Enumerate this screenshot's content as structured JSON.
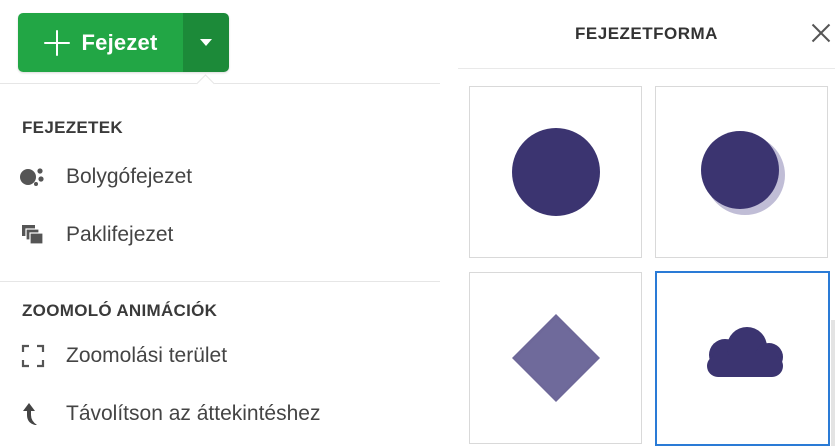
{
  "toolbar": {
    "add_button_label": "Fejezet",
    "add_icon": "plus-icon",
    "dropdown_icon": "caret-down-icon",
    "accent_color": "#22a645",
    "accent_dark": "#1c8a39"
  },
  "menu": {
    "section_chapters": {
      "title": "FEJEZETEK",
      "items": [
        {
          "label": "Bolygófejezet",
          "icon": "planet-topic-icon"
        },
        {
          "label": "Paklifejezet",
          "icon": "stack-topic-icon"
        }
      ]
    },
    "section_zoom": {
      "title": "ZOOMOLÓ ANIMÁCIÓK",
      "items": [
        {
          "label": "Zoomolási terület",
          "icon": "zoom-area-icon"
        },
        {
          "label": "Távolítson az áttekintéshez",
          "icon": "zoom-out-arrow-icon"
        }
      ]
    }
  },
  "shape_panel": {
    "title": "FEJEZETFORMA",
    "close_icon": "close-icon",
    "shape_color": "#3b3470",
    "selected_border_color": "#2a7bd6",
    "shapes": [
      {
        "name": "circle",
        "selected": false
      },
      {
        "name": "circle-shadow",
        "selected": false
      },
      {
        "name": "diamond",
        "selected": false
      },
      {
        "name": "cloud",
        "selected": true
      }
    ]
  }
}
